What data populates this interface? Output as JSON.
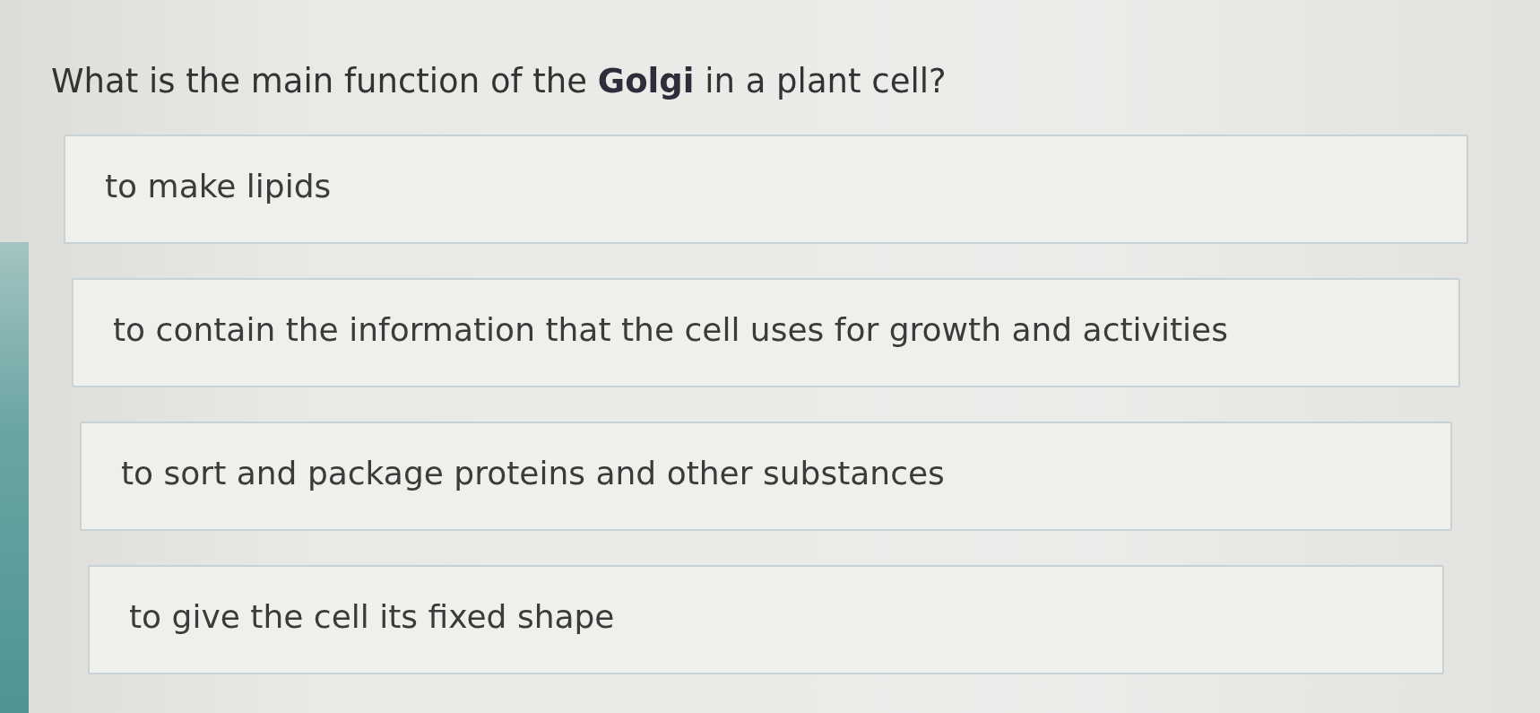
{
  "question": "What is the main function of the **Golgi** in a plant cell?",
  "answers": [
    {
      "text": "to make lipids"
    },
    {
      "text": "to contain the information that the cell uses for growth and activities"
    },
    {
      "text": "to sort and package proteins and other substances"
    },
    {
      "text": "to give the cell its fixed shape"
    }
  ]
}
